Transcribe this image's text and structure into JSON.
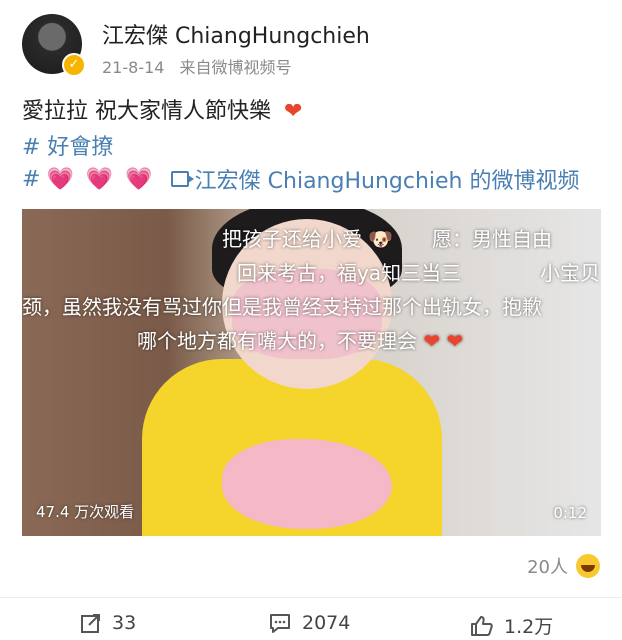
{
  "header": {
    "username": "江宏傑 ChiangHungchieh",
    "date": "21-8-14",
    "source": "来自微博视频号"
  },
  "post": {
    "text": "愛拉拉 祝大家情人節快樂",
    "hashtag": "# 好會撩",
    "tag_prefix": "#",
    "video_link": "江宏傑 ChiangHungchieh 的微博视频"
  },
  "video": {
    "overlay": [
      "把孩子还给小爱",
      "愿：男性自由",
      "回来考古，福ya知三当三",
      "小宝贝",
      "颈，虽然我没有骂过你但是我曾经支持过那个出轨女，抱歉",
      "哪个地方都有嘴大的，不要理会"
    ],
    "views": "47.4 万次观看",
    "duration": "0:12"
  },
  "reactions": {
    "count": "20人"
  },
  "actions": {
    "share": "33",
    "comment": "2074",
    "like": "1.2万"
  },
  "colors": {
    "link": "#4a7fb3",
    "heart_pink": "#ff5fa8",
    "heart_red": "#e8452c",
    "shirt": "#f5d52b"
  },
  "icons": [
    "verified-badge-icon",
    "pink-heart-icon",
    "video-link-icon",
    "red-heart-icon",
    "grin-emoji-icon",
    "share-icon",
    "comment-icon",
    "like-icon"
  ]
}
